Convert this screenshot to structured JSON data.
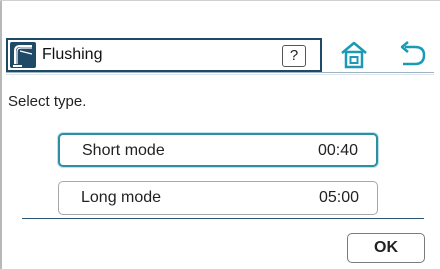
{
  "header": {
    "title": "Flushing",
    "help_label": "?",
    "title_icon": "faucet-icon",
    "home_icon": "home-icon",
    "back_icon": "back-arrow-icon"
  },
  "prompt": "Select type.",
  "modes": [
    {
      "name": "Short mode",
      "time": "00:40",
      "selected": true
    },
    {
      "name": "Long mode",
      "time": "05:00",
      "selected": false
    }
  ],
  "ok_label": "OK",
  "colors": {
    "accent": "#1f4a67",
    "selected_border": "#2d8ea4",
    "home_icon": "#1a9ab5",
    "back_icon": "#1a9ab5"
  }
}
